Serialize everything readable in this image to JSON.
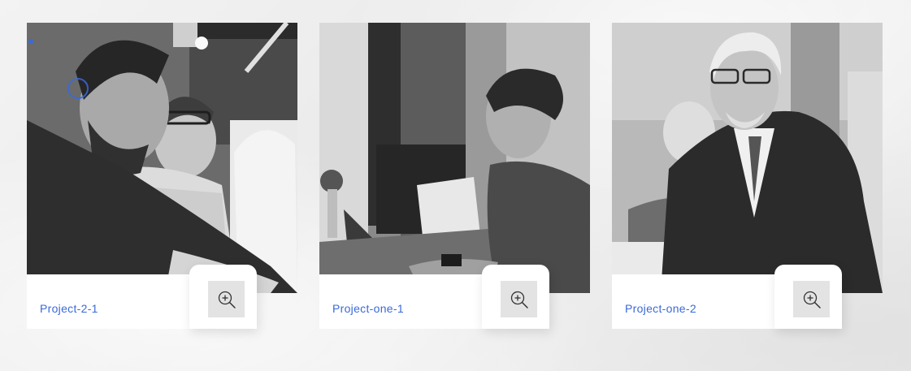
{
  "gallery": {
    "items": [
      {
        "title": "Project-2-1",
        "zoom_icon": "zoom-in-icon"
      },
      {
        "title": "Project-one-1",
        "zoom_icon": "zoom-in-icon"
      },
      {
        "title": "Project-one-2",
        "zoom_icon": "zoom-in-icon"
      }
    ]
  },
  "colors": {
    "link": "#3a6ad8",
    "zoom_button_bg": "#e3e3e3",
    "card_bg": "#ffffff"
  }
}
